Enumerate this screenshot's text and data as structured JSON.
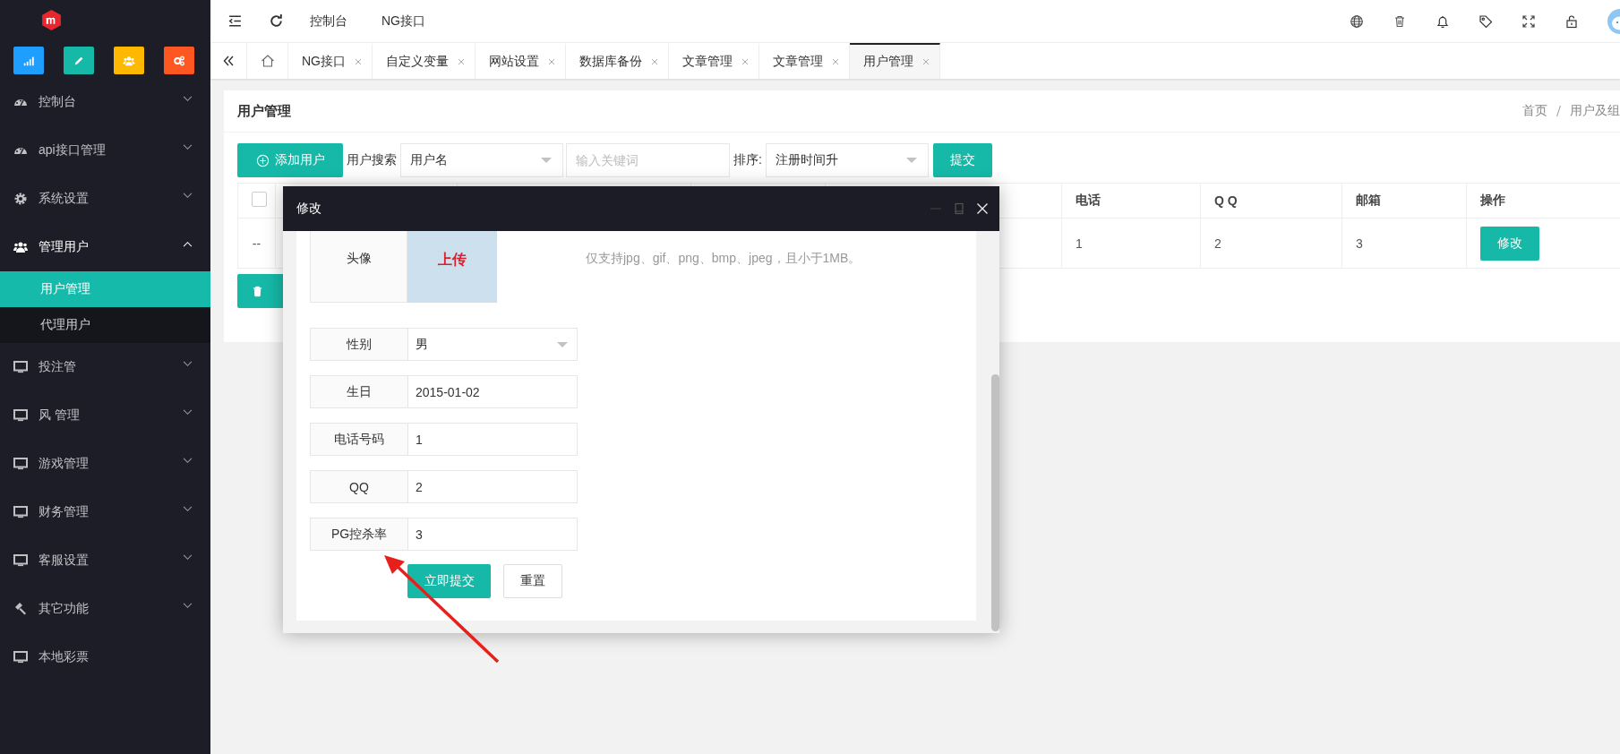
{
  "sidebar": {
    "quick_buttons": [
      {
        "kind": "signal",
        "color": "#1e9fff"
      },
      {
        "kind": "pencil",
        "color": "#16b9a8"
      },
      {
        "kind": "users",
        "color": "#ffb800"
      },
      {
        "kind": "gears",
        "color": "#ff5722"
      }
    ],
    "menu": [
      {
        "label": "控制台",
        "kind": "gauge",
        "expanded": false
      },
      {
        "label": "api接口管理",
        "kind": "gauge",
        "expanded": false
      },
      {
        "label": "系统设置",
        "kind": "gear",
        "expanded": false
      },
      {
        "label": "管理用户",
        "kind": "users",
        "expanded": true,
        "children": [
          {
            "label": "用户管理",
            "selected": true
          },
          {
            "label": "代理用户",
            "selected": false
          }
        ]
      },
      {
        "label": "投注管",
        "kind": "monitor",
        "expanded": false
      },
      {
        "label": "风 管理",
        "kind": "monitor",
        "expanded": false
      },
      {
        "label": "游戏管理",
        "kind": "monitor",
        "expanded": false
      },
      {
        "label": "财务管理",
        "kind": "monitor",
        "expanded": false
      },
      {
        "label": "客服设置",
        "kind": "monitor",
        "expanded": false
      },
      {
        "label": "其它功能",
        "kind": "hammer",
        "expanded": false
      },
      {
        "label": "本地彩票",
        "kind": "monitor"
      }
    ]
  },
  "header": {
    "links": [
      "控制台",
      "NG接口"
    ]
  },
  "tabs": [
    {
      "label": "NG接口",
      "selected": false
    },
    {
      "label": "自定义变量",
      "selected": false
    },
    {
      "label": "网站设置",
      "selected": false
    },
    {
      "label": "数据库备份",
      "selected": false
    },
    {
      "label": "文章管理",
      "selected": false
    },
    {
      "label": "文章管理",
      "selected": false
    },
    {
      "label": "用户管理",
      "selected": true
    }
  ],
  "page": {
    "title": "用户管理",
    "breadcrumb": [
      "首页",
      "用户及组"
    ],
    "toolbar": {
      "add_button": "添加用户",
      "search_label": "用户搜索",
      "search_by": "用户名",
      "keyword_placeholder": "输入关键词",
      "sort_label": "排序:",
      "sort_by": "注册时间升",
      "submit_button": "提交"
    },
    "table": {
      "header_checked": false,
      "columns": [
        "电话",
        "Q Q",
        "邮箱",
        "操作"
      ],
      "rows": [
        {
          "lead": "--",
          "cells": [
            "1",
            "2",
            "3"
          ],
          "action": "修改"
        }
      ]
    }
  },
  "dialog": {
    "title": "修改",
    "avatar": {
      "label": "头像",
      "upload": "上传",
      "hint": "仅支持jpg、gif、png、bmp、jpeg，且小于1MB。"
    },
    "fields": [
      {
        "label": "性别",
        "kind": "select",
        "value": "男"
      },
      {
        "label": "生日",
        "kind": "input",
        "value": "2015-01-02"
      },
      {
        "label": "电话号码",
        "kind": "input",
        "value": "1"
      },
      {
        "label": "QQ",
        "kind": "input",
        "value": "2"
      },
      {
        "label": "PG控杀率",
        "kind": "input",
        "value": "3"
      }
    ],
    "submit": "立即提交",
    "reset": "重置"
  }
}
